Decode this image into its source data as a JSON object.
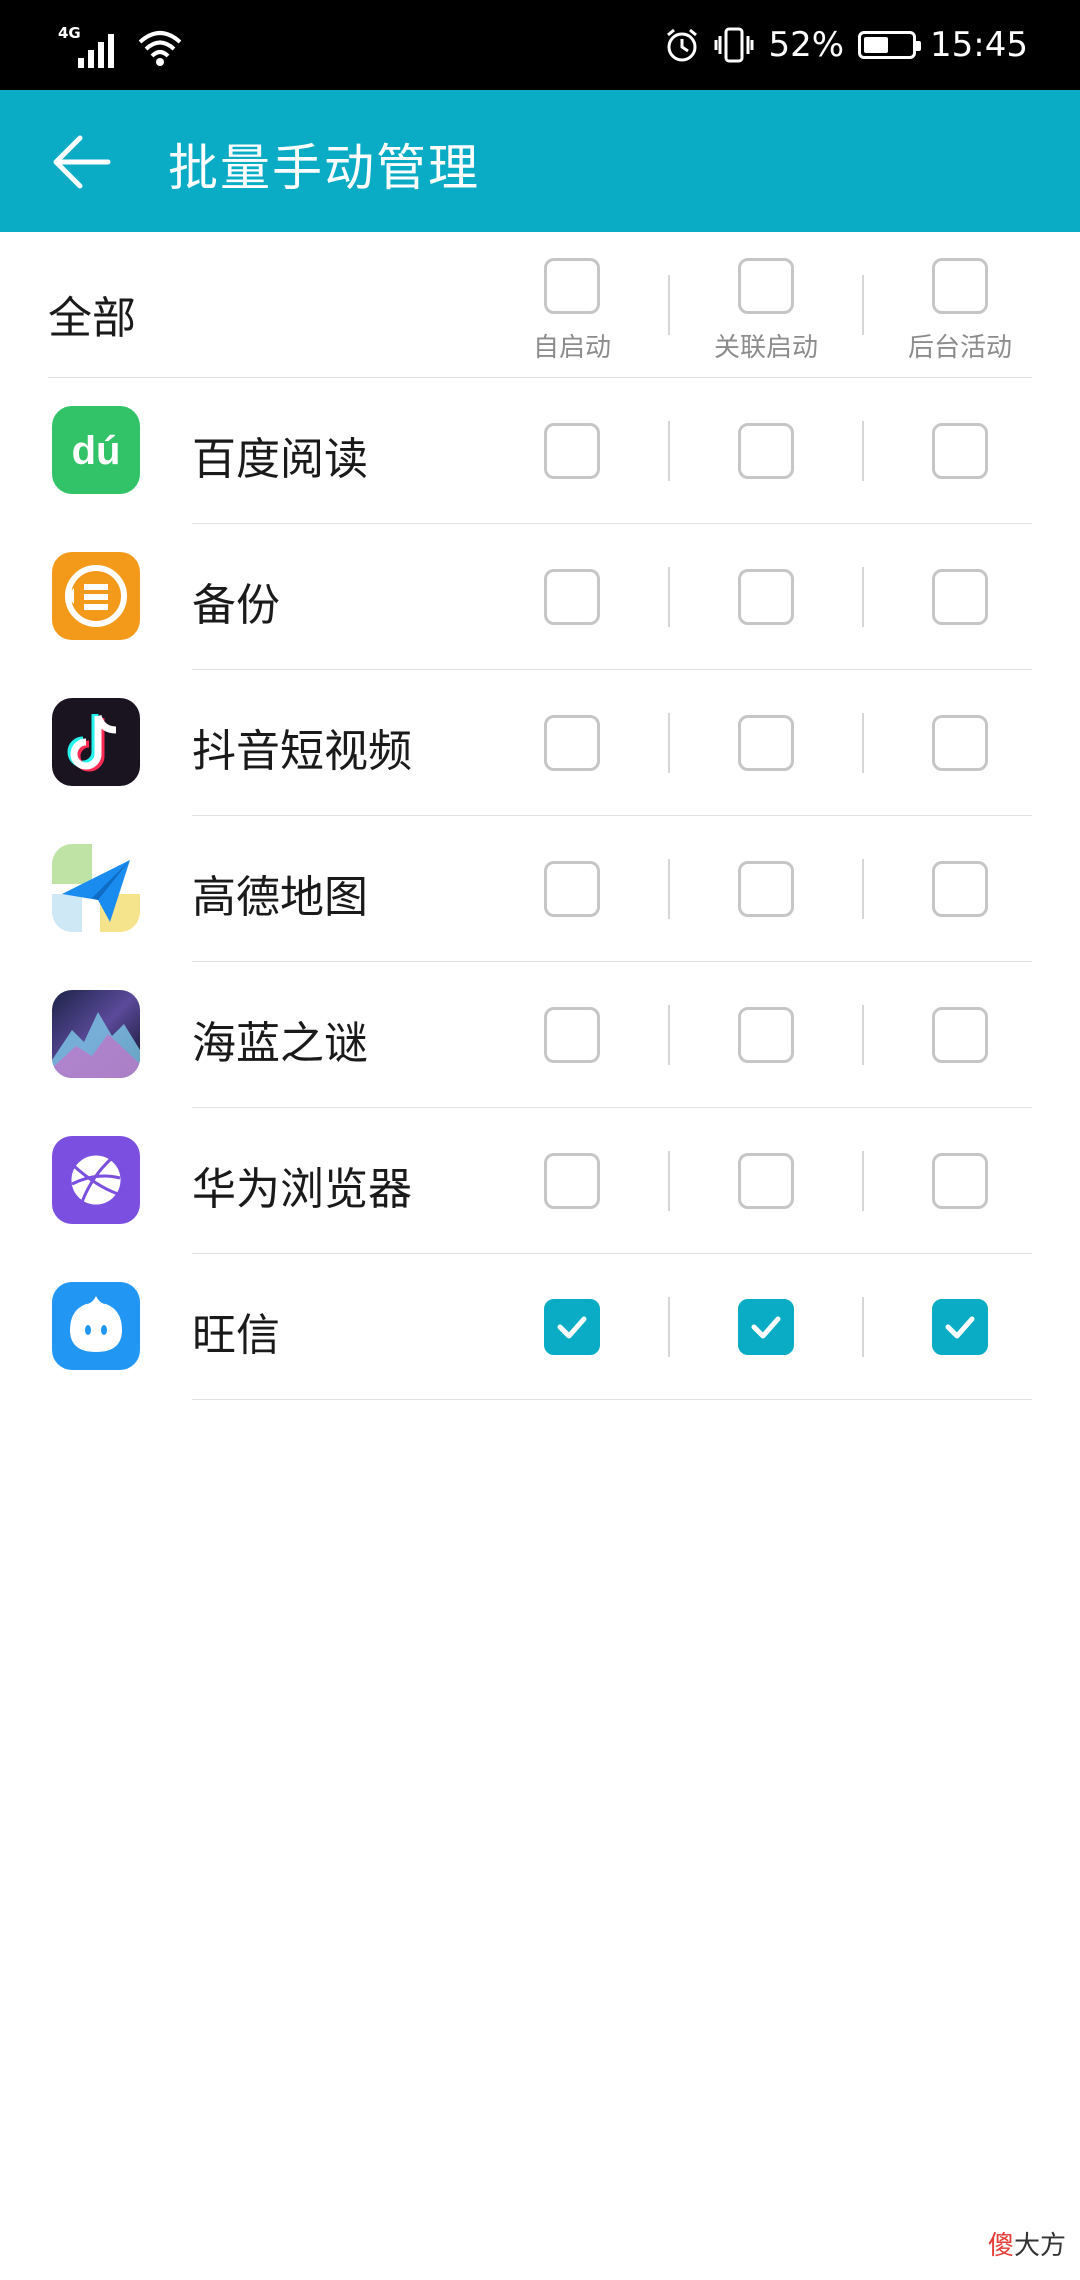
{
  "status_bar": {
    "network": "4G",
    "battery_percent": "52%",
    "battery_level": 0.52,
    "time": "15:45"
  },
  "title_bar": {
    "title": "批量手动管理"
  },
  "header": {
    "all_label": "全部",
    "columns": [
      "自启动",
      "关联启动",
      "后台活动"
    ],
    "all_checked": [
      false,
      false,
      false
    ]
  },
  "apps": [
    {
      "name": "百度阅读",
      "icon": "baidu-read-icon",
      "checked": [
        false,
        false,
        false
      ]
    },
    {
      "name": "备份",
      "icon": "backup-icon",
      "checked": [
        false,
        false,
        false
      ]
    },
    {
      "name": "抖音短视频",
      "icon": "douyin-icon",
      "checked": [
        false,
        false,
        false
      ]
    },
    {
      "name": "高德地图",
      "icon": "amap-icon",
      "checked": [
        false,
        false,
        false
      ]
    },
    {
      "name": "海蓝之谜",
      "icon": "hailan-icon",
      "checked": [
        false,
        false,
        false
      ]
    },
    {
      "name": "华为浏览器",
      "icon": "huawei-browser-icon",
      "checked": [
        false,
        false,
        false
      ]
    },
    {
      "name": "旺信",
      "icon": "wangxin-icon",
      "checked": [
        true,
        true,
        true
      ]
    }
  ],
  "colors": {
    "accent": "#0aacc5",
    "checkbox_border": "#c6c6c6"
  },
  "watermark": {
    "accent_char": "傻",
    "rest": "大方"
  }
}
